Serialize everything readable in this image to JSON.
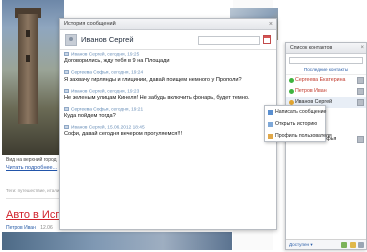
{
  "blog": {
    "photo_caption": "Вид на верхний город",
    "more_link": "Читать подробнее...",
    "tags": "Теги: путешествие, италия",
    "post_title": "Авто в Испан",
    "post_author": "Петров Иван",
    "post_date": "12.06"
  },
  "history_window": {
    "title": "История сообщений",
    "contact_name": "Иванов Сергей",
    "messages": [
      {
        "author": "Иванов Сергей",
        "time": "сегодня, 19:25",
        "text": "Договорились, жду тебя в 9 на Площади"
      },
      {
        "author": "Сергеева Софья",
        "time": "сегодня, 19:24",
        "text": "Я захвачу гирлянды и глицинии, давай поищем немного у Прополи?"
      },
      {
        "author": "Иванов Сергей",
        "time": "сегодня, 19:23",
        "text": "Не зеленым улицам Кинеля! Не забудь включить фонарь, будет темно."
      },
      {
        "author": "Сергеева Софья",
        "time": "сегодня, 19:21",
        "text": "Куда пойдем тогда?"
      },
      {
        "author": "Иванов Сергей",
        "time": "15.06.2012 18:45",
        "text": "Софи, давай сегодня вечером прогуляемся!!!"
      }
    ]
  },
  "contacts_panel": {
    "title": "Список контактов",
    "recent_link": "Последние контакты",
    "contacts": [
      {
        "name": "Сергеева Екатерина",
        "status_color": "#3fb33f",
        "name_color": "#c0392b"
      },
      {
        "name": "Петров Иван",
        "status_color": "#3fb33f",
        "name_color": "#c0392b"
      },
      {
        "name": "Иванов Сергей",
        "status_color": "#e1a531",
        "name_color": "#222222"
      },
      {
        "name": "Сергеева Софья",
        "status_color": "#d84a3a",
        "name_color": "#222222"
      }
    ],
    "footer_status": "Доступен"
  },
  "context_menu": {
    "items": [
      {
        "label": "Написать сообщение",
        "icon": "pencil-icon"
      },
      {
        "label": "Открыть историю",
        "icon": "history-icon"
      },
      {
        "label": "Профиль пользователя",
        "icon": "user-icon"
      }
    ]
  }
}
